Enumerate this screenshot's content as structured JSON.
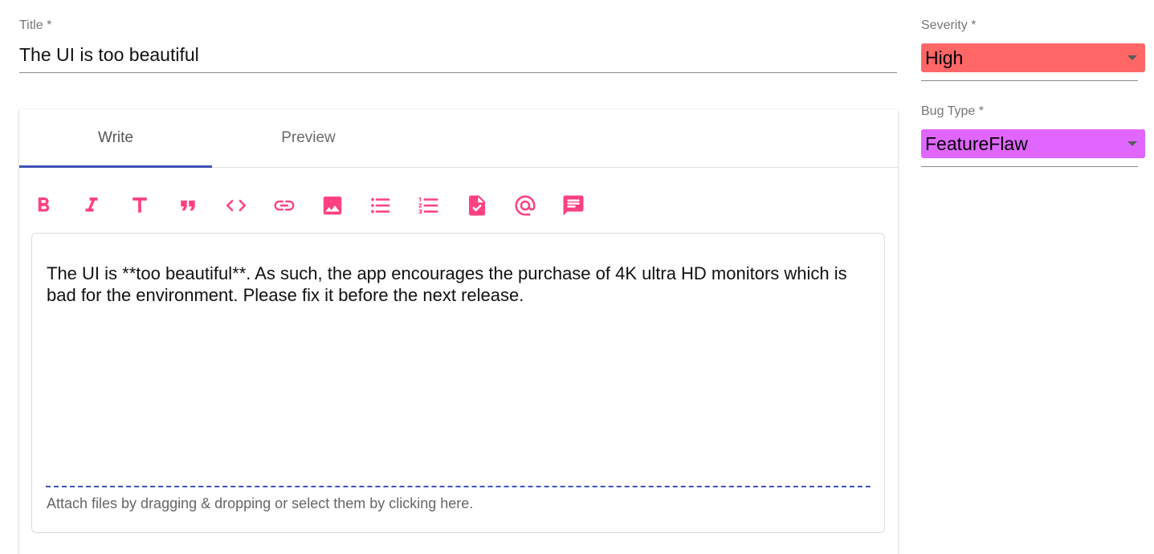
{
  "title_field": {
    "label": "Title *",
    "value": "The UI is too beautiful"
  },
  "editor": {
    "tabs": [
      {
        "label": "Write",
        "active": true
      },
      {
        "label": "Preview",
        "active": false
      }
    ],
    "toolbar": [
      "bold-icon",
      "italic-icon",
      "header-icon",
      "quote-icon",
      "code-icon",
      "link-icon",
      "image-icon",
      "unordered-list-icon",
      "ordered-list-icon",
      "task-list-icon",
      "mention-icon",
      "comment-icon"
    ],
    "body": "The UI is **too beautiful**. As such, the app encourages the purchase of 4K ultra HD monitors which is bad for the environment. Please fix it before the next release.",
    "attach_hint": "Attach files by dragging & dropping or select them by clicking here."
  },
  "severity": {
    "label": "Severity *",
    "value": "High",
    "color": "#ff6666"
  },
  "bug_type": {
    "label": "Bug Type *",
    "value": "FeatureFlaw",
    "color": "#e066ff"
  },
  "colors": {
    "accent": "#ff4081",
    "tab_indicator": "#3f51b5"
  }
}
